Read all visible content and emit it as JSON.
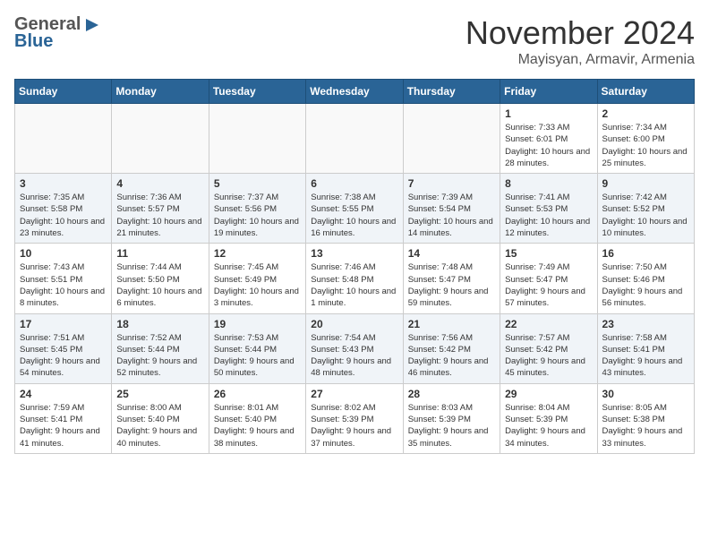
{
  "logo": {
    "general": "General",
    "blue": "Blue"
  },
  "header": {
    "month": "November 2024",
    "location": "Mayisyan, Armavir, Armenia"
  },
  "days_of_week": [
    "Sunday",
    "Monday",
    "Tuesday",
    "Wednesday",
    "Thursday",
    "Friday",
    "Saturday"
  ],
  "weeks": [
    [
      {
        "day": "",
        "info": ""
      },
      {
        "day": "",
        "info": ""
      },
      {
        "day": "",
        "info": ""
      },
      {
        "day": "",
        "info": ""
      },
      {
        "day": "",
        "info": ""
      },
      {
        "day": "1",
        "info": "Sunrise: 7:33 AM\nSunset: 6:01 PM\nDaylight: 10 hours and 28 minutes."
      },
      {
        "day": "2",
        "info": "Sunrise: 7:34 AM\nSunset: 6:00 PM\nDaylight: 10 hours and 25 minutes."
      }
    ],
    [
      {
        "day": "3",
        "info": "Sunrise: 7:35 AM\nSunset: 5:58 PM\nDaylight: 10 hours and 23 minutes."
      },
      {
        "day": "4",
        "info": "Sunrise: 7:36 AM\nSunset: 5:57 PM\nDaylight: 10 hours and 21 minutes."
      },
      {
        "day": "5",
        "info": "Sunrise: 7:37 AM\nSunset: 5:56 PM\nDaylight: 10 hours and 19 minutes."
      },
      {
        "day": "6",
        "info": "Sunrise: 7:38 AM\nSunset: 5:55 PM\nDaylight: 10 hours and 16 minutes."
      },
      {
        "day": "7",
        "info": "Sunrise: 7:39 AM\nSunset: 5:54 PM\nDaylight: 10 hours and 14 minutes."
      },
      {
        "day": "8",
        "info": "Sunrise: 7:41 AM\nSunset: 5:53 PM\nDaylight: 10 hours and 12 minutes."
      },
      {
        "day": "9",
        "info": "Sunrise: 7:42 AM\nSunset: 5:52 PM\nDaylight: 10 hours and 10 minutes."
      }
    ],
    [
      {
        "day": "10",
        "info": "Sunrise: 7:43 AM\nSunset: 5:51 PM\nDaylight: 10 hours and 8 minutes."
      },
      {
        "day": "11",
        "info": "Sunrise: 7:44 AM\nSunset: 5:50 PM\nDaylight: 10 hours and 6 minutes."
      },
      {
        "day": "12",
        "info": "Sunrise: 7:45 AM\nSunset: 5:49 PM\nDaylight: 10 hours and 3 minutes."
      },
      {
        "day": "13",
        "info": "Sunrise: 7:46 AM\nSunset: 5:48 PM\nDaylight: 10 hours and 1 minute."
      },
      {
        "day": "14",
        "info": "Sunrise: 7:48 AM\nSunset: 5:47 PM\nDaylight: 9 hours and 59 minutes."
      },
      {
        "day": "15",
        "info": "Sunrise: 7:49 AM\nSunset: 5:47 PM\nDaylight: 9 hours and 57 minutes."
      },
      {
        "day": "16",
        "info": "Sunrise: 7:50 AM\nSunset: 5:46 PM\nDaylight: 9 hours and 56 minutes."
      }
    ],
    [
      {
        "day": "17",
        "info": "Sunrise: 7:51 AM\nSunset: 5:45 PM\nDaylight: 9 hours and 54 minutes."
      },
      {
        "day": "18",
        "info": "Sunrise: 7:52 AM\nSunset: 5:44 PM\nDaylight: 9 hours and 52 minutes."
      },
      {
        "day": "19",
        "info": "Sunrise: 7:53 AM\nSunset: 5:44 PM\nDaylight: 9 hours and 50 minutes."
      },
      {
        "day": "20",
        "info": "Sunrise: 7:54 AM\nSunset: 5:43 PM\nDaylight: 9 hours and 48 minutes."
      },
      {
        "day": "21",
        "info": "Sunrise: 7:56 AM\nSunset: 5:42 PM\nDaylight: 9 hours and 46 minutes."
      },
      {
        "day": "22",
        "info": "Sunrise: 7:57 AM\nSunset: 5:42 PM\nDaylight: 9 hours and 45 minutes."
      },
      {
        "day": "23",
        "info": "Sunrise: 7:58 AM\nSunset: 5:41 PM\nDaylight: 9 hours and 43 minutes."
      }
    ],
    [
      {
        "day": "24",
        "info": "Sunrise: 7:59 AM\nSunset: 5:41 PM\nDaylight: 9 hours and 41 minutes."
      },
      {
        "day": "25",
        "info": "Sunrise: 8:00 AM\nSunset: 5:40 PM\nDaylight: 9 hours and 40 minutes."
      },
      {
        "day": "26",
        "info": "Sunrise: 8:01 AM\nSunset: 5:40 PM\nDaylight: 9 hours and 38 minutes."
      },
      {
        "day": "27",
        "info": "Sunrise: 8:02 AM\nSunset: 5:39 PM\nDaylight: 9 hours and 37 minutes."
      },
      {
        "day": "28",
        "info": "Sunrise: 8:03 AM\nSunset: 5:39 PM\nDaylight: 9 hours and 35 minutes."
      },
      {
        "day": "29",
        "info": "Sunrise: 8:04 AM\nSunset: 5:39 PM\nDaylight: 9 hours and 34 minutes."
      },
      {
        "day": "30",
        "info": "Sunrise: 8:05 AM\nSunset: 5:38 PM\nDaylight: 9 hours and 33 minutes."
      }
    ]
  ]
}
